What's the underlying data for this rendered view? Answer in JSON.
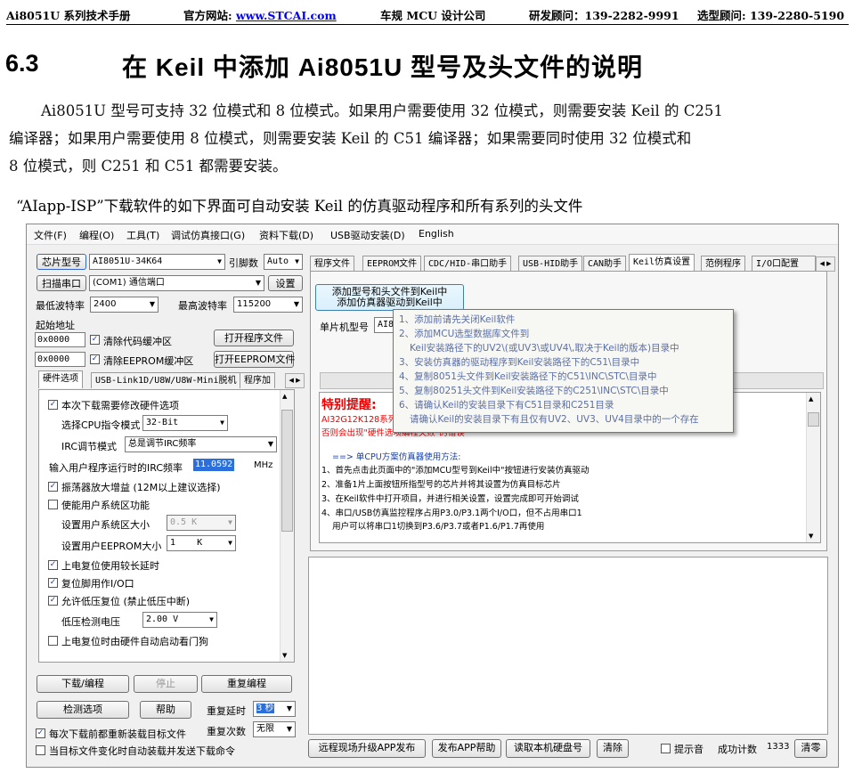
{
  "header": {
    "manual": "Ai8051U 系列技术手册",
    "site_label": "官方网站: ",
    "site_url": "www.STCAI.com",
    "company": "车规 MCU 设计公司",
    "dev_contact": "研发顾问：139-2282-9991",
    "sel_contact": "选型顾问: 139-2280-5190"
  },
  "section": {
    "number": "6.3",
    "title": "在 Keil 中添加 Ai8051U 型号及头文件的说明"
  },
  "body": {
    "para1_line1": "Ai8051U 型号可支持 32 位模式和 8 位模式。如果用户需要使用 32 位模式，则需要安装 Keil 的 C251",
    "para1_line2": "编译器；如果用户需要使用 8 位模式，则需要安装 Keil 的 C51 编译器；如果需要同时使用 32 位模式和",
    "para1_line3": "8 位模式，则 C251 和 C51 都需要安装。",
    "caption": "“AIapp-ISP”下载软件的如下界面可自动安装 Keil 的仿真驱动程序和所有系列的头文件"
  },
  "app": {
    "menu": [
      "文件(F)",
      "编程(O)",
      "工具(T)",
      "调试仿真接口(G)",
      "资料下载(D)",
      "USB驱动安装(D)",
      "English"
    ],
    "chip_type_button": "芯片型号",
    "chip_type_value": "AI8051U-34K64",
    "pin_label": "引脚数",
    "pin_value": "Auto",
    "scan_button": "扫描串口",
    "port_value": "(COM1) 通信端口",
    "settings_button": "设置",
    "min_baud_label": "最低波特率",
    "min_baud_value": "2400",
    "max_baud_label": "最高波特率",
    "max_baud_value": "115200",
    "start_addr_label": "起始地址",
    "addr1": "0x0000",
    "clear_code_label": "清除代码缓冲区",
    "open_program_button": "打开程序文件",
    "addr2": "0x0000",
    "clear_eeprom_label": "清除EEPROM缓冲区",
    "open_eeprom_button": "打开EEPROM文件",
    "left_tabs": [
      "硬件选项",
      "USB-Link1D/U8W/U8W-Mini脱机",
      "程序加"
    ],
    "hw_options": {
      "modify_hw": "本次下载需要修改硬件选项",
      "cpu_mode_label": "选择CPU指令模式",
      "cpu_mode_value": "32-Bit",
      "irc_mode_label": "IRC调节模式",
      "irc_mode_value": "总是调节IRC频率",
      "irc_freq_label": "输入用户程序运行时的IRC频率",
      "irc_freq_value": "11.0592",
      "irc_freq_unit": "MHz",
      "osc_gain": "振荡器放大增益 (12M以上建议选择)",
      "user_sys_area": "使能用户系统区功能",
      "sys_size_label": "设置用户系统区大小",
      "sys_size_value": "0.5 K",
      "eeprom_size_label": "设置用户EEPROM大小",
      "eeprom_size_value": "1    K",
      "long_delay": "上电复位使用较长延时",
      "reset_pin": "复位脚用作I/O口",
      "lvr": "允许低压复位 (禁止低压中断)",
      "lvd_label": "低压检测电压",
      "lvd_value": "2.00 V",
      "watchdog": "上电复位时由硬件自动启动看门狗"
    },
    "download_button": "下载/编程",
    "stop_button": "停止",
    "reprogram_button": "重复编程",
    "check_button": "检测选项",
    "help_button": "帮助",
    "repeat_delay_label": "重复延时",
    "repeat_delay_value": "3 秒",
    "repeat_count_label": "重复次数",
    "repeat_count_value": "无限",
    "reload_label": "每次下载前都重新装载目标文件",
    "auto_send_label": "当目标文件变化时自动装载并发送下载命令",
    "right_tabs": [
      "程序文件",
      "EEPROM文件",
      "CDC/HID-串口助手",
      "USB-HID助手",
      "CAN助手",
      "Keil仿真设置",
      "范例程序",
      "I/O口配置"
    ],
    "keil_button_line1": "添加型号和头文件到Keil中",
    "keil_button_line2": "添加仿真器驱动到Keil中",
    "mcu_model_label": "单片机型号",
    "mcu_model_value": "AI8",
    "tooltip": [
      "1、添加前请先关闭Keil软件",
      "2、添加MCU选型数据库文件到",
      "Keil安装路径下的UV2\\(或UV3\\或UV4\\,取决于Keil的版本)目录中",
      "3、安装仿真器的驱动程序到Keil安装路径下的C51\\目录中",
      "4、复制8051头文件到Keil安装路径下的C51\\INC\\STC\\目录中",
      "5、复制80251头文件到Keil安装路径下的C251\\INC\\STC\\目录中",
      "6、请确认Keil的安装目录下有C51目录和C251目录",
      "请确认Keil的安装目录下有且仅有UV2、UV3、UV4目录中的一个存在"
    ],
    "notice_title": "特别提醒:",
    "notice_line1": "AI32G12K128系列",
    "notice_line2": "否则会出现\"硬件选项编程失败\"的错误",
    "usage_title": "==> 单CPU方案仿真器使用方法:",
    "usage": [
      "1、首先点击此页面中的\"添加MCU型号到Keil中\"按钮进行安装仿真驱动",
      "2、准备1片上面按钮所指型号的芯片并将其设置为仿真目标芯片",
      "3、在Keil软件中打开项目，并进行相关设置，设置完成即可开始调试",
      "4、串口/USB仿真监控程序占用P3.0/P3.1两个I/O口，但不占用串口1",
      "    用户可以将串口1切换到P3.6/P3.7或者P1.6/P1.7再使用"
    ],
    "remote_upgrade_button": "远程现场升级APP发布",
    "publish_help_button": "发布APP帮助",
    "read_disk_button": "读取本机硬盘号",
    "clear_button": "清除",
    "beep_label": "提示音",
    "success_label": "成功计数",
    "success_count": "1333",
    "reset_count_button": "清零"
  },
  "colors": {
    "link": "#0000ff",
    "notice": "#e00000",
    "tooltip_text": "#5b6fa6",
    "highlight": "#2a6fdb"
  }
}
